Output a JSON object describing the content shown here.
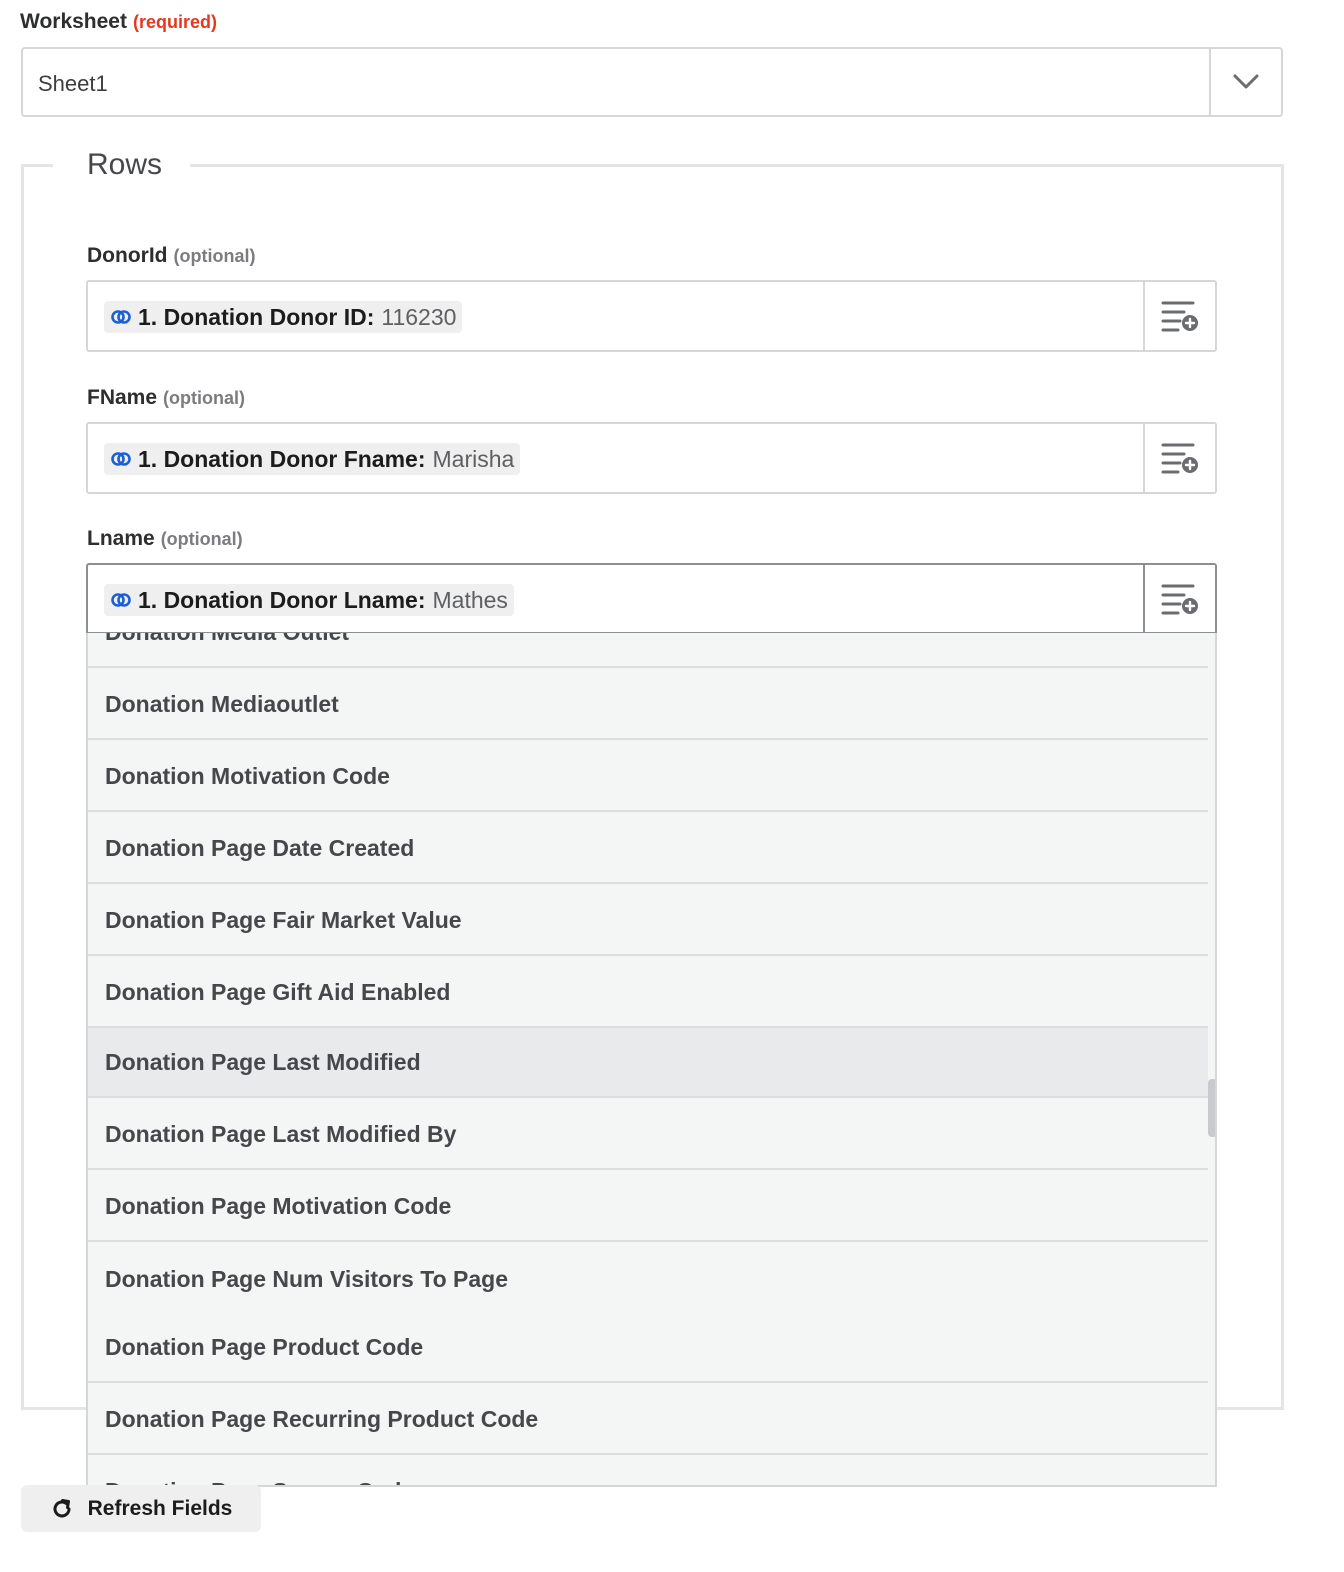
{
  "worksheet": {
    "label": "Worksheet",
    "required": "(required)",
    "value": "Sheet1"
  },
  "rows": {
    "title": "Rows"
  },
  "fields": [
    {
      "label": "DonorId",
      "tag": "(optional)",
      "pill_name": "1. Donation Donor ID:",
      "pill_value": "116230"
    },
    {
      "label": "FName",
      "tag": "(optional)",
      "pill_name": "1. Donation Donor Fname:",
      "pill_value": "Marisha"
    },
    {
      "label": "Lname",
      "tag": "(optional)",
      "pill_name": "1. Donation Donor Lname:",
      "pill_value": "Mathes"
    }
  ],
  "dropdown": {
    "options": [
      "Donation Media Outlet",
      "Donation Mediaoutlet",
      "Donation Motivation Code",
      "Donation Page Date Created",
      "Donation Page Fair Market Value",
      "Donation Page Gift Aid Enabled",
      "Donation Page Last Modified",
      "Donation Page Last Modified By",
      "Donation Page Motivation Code",
      "Donation Page Num Visitors To Page",
      "Donation Page Product Code",
      "Donation Page Recurring Product Code",
      "Donation Page Source Code"
    ],
    "highlighted_index": 6
  },
  "refresh_button": {
    "label": "Refresh Fields"
  },
  "colors": {
    "required": "#e8371e",
    "link_icon": "#1b5fd6",
    "highlight": "#e8eaec"
  }
}
